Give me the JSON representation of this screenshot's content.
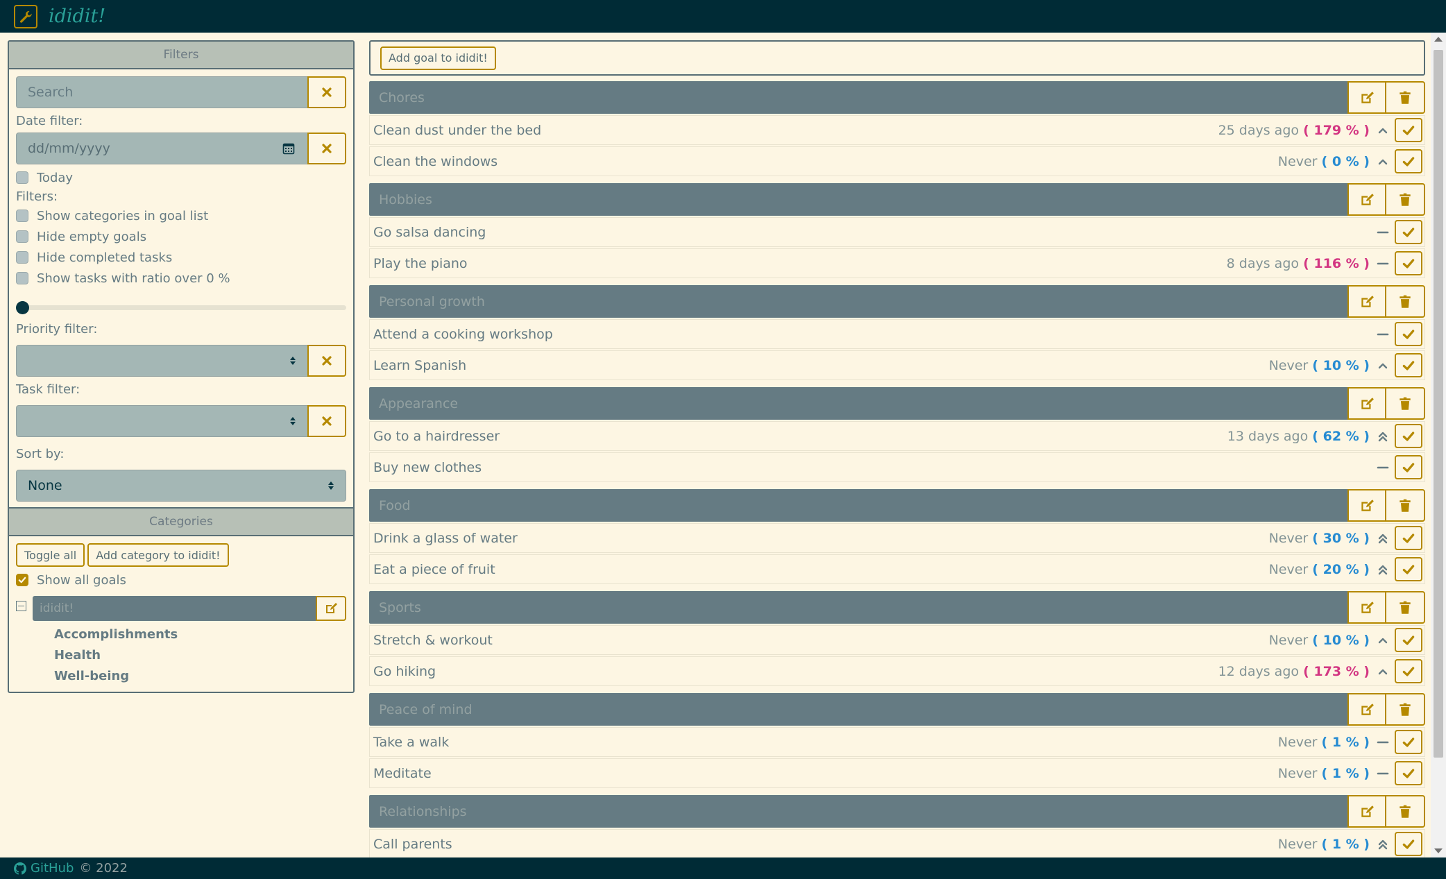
{
  "app": {
    "title": "ididit!",
    "logo_icon": "wrench-icon"
  },
  "footer": {
    "github_label": "GitHub",
    "copyright": "© 2022"
  },
  "sidebar": {
    "filters_header": "Filters",
    "search_placeholder": "Search",
    "date_label": "Date filter:",
    "date_placeholder": "dd/mm/yyyy",
    "today_label": "Today",
    "filters_label": "Filters:",
    "filter_options": [
      "Show categories in goal list",
      "Hide empty goals",
      "Hide completed tasks",
      "Show tasks with ratio over 0 %"
    ],
    "ratio_slider_value": 0,
    "priority_label": "Priority filter:",
    "task_label": "Task filter:",
    "sort_label": "Sort by:",
    "sort_value": "None",
    "categories_header": "Categories",
    "toggle_all": "Toggle all",
    "add_category": "Add category to ididit!",
    "show_all_goals": "Show all goals",
    "tree_root": "ididit!",
    "sub_categories": [
      "Accomplishments",
      "Health",
      "Well-being"
    ]
  },
  "main": {
    "add_goal": "Add goal to ididit!",
    "groups": [
      {
        "name": "Chores",
        "goals": [
          {
            "name": "Clean dust under the bed",
            "when": "25 days ago",
            "pct": "179 %",
            "pct_color": "red",
            "priority": "up"
          },
          {
            "name": "Clean the windows",
            "when": "Never",
            "pct": "0 %",
            "pct_color": "blue",
            "priority": "up"
          }
        ]
      },
      {
        "name": "Hobbies",
        "goals": [
          {
            "name": "Go salsa dancing",
            "when": "",
            "pct": "",
            "pct_color": "",
            "priority": "flat"
          },
          {
            "name": "Play the piano",
            "when": "8 days ago",
            "pct": "116 %",
            "pct_color": "red",
            "priority": "flat"
          }
        ]
      },
      {
        "name": "Personal growth",
        "goals": [
          {
            "name": "Attend a cooking workshop",
            "when": "",
            "pct": "",
            "pct_color": "",
            "priority": "flat"
          },
          {
            "name": "Learn Spanish",
            "when": "Never",
            "pct": "10 %",
            "pct_color": "blue",
            "priority": "up"
          }
        ]
      },
      {
        "name": "Appearance",
        "goals": [
          {
            "name": "Go to a hairdresser",
            "when": "13 days ago",
            "pct": "62 %",
            "pct_color": "blue",
            "priority": "double-up"
          },
          {
            "name": "Buy new clothes",
            "when": "",
            "pct": "",
            "pct_color": "",
            "priority": "flat"
          }
        ]
      },
      {
        "name": "Food",
        "goals": [
          {
            "name": "Drink a glass of water",
            "when": "Never",
            "pct": "30 %",
            "pct_color": "blue",
            "priority": "double-up"
          },
          {
            "name": "Eat a piece of fruit",
            "when": "Never",
            "pct": "20 %",
            "pct_color": "blue",
            "priority": "double-up"
          }
        ]
      },
      {
        "name": "Sports",
        "goals": [
          {
            "name": "Stretch & workout",
            "when": "Never",
            "pct": "10 %",
            "pct_color": "blue",
            "priority": "up"
          },
          {
            "name": "Go hiking",
            "when": "12 days ago",
            "pct": "173 %",
            "pct_color": "red",
            "priority": "up"
          }
        ]
      },
      {
        "name": "Peace of mind",
        "goals": [
          {
            "name": "Take a walk",
            "when": "Never",
            "pct": "1 %",
            "pct_color": "blue",
            "priority": "flat"
          },
          {
            "name": "Meditate",
            "when": "Never",
            "pct": "1 %",
            "pct_color": "blue",
            "priority": "flat"
          }
        ]
      },
      {
        "name": "Relationships",
        "goals": [
          {
            "name": "Call parents",
            "when": "Never",
            "pct": "1 %",
            "pct_color": "blue",
            "priority": "double-up"
          }
        ]
      }
    ]
  },
  "colors": {
    "accent": "#b58900",
    "bar": "#002b36",
    "category": "#657b83",
    "pct_red": "#d33682",
    "pct_blue": "#268bd2"
  }
}
